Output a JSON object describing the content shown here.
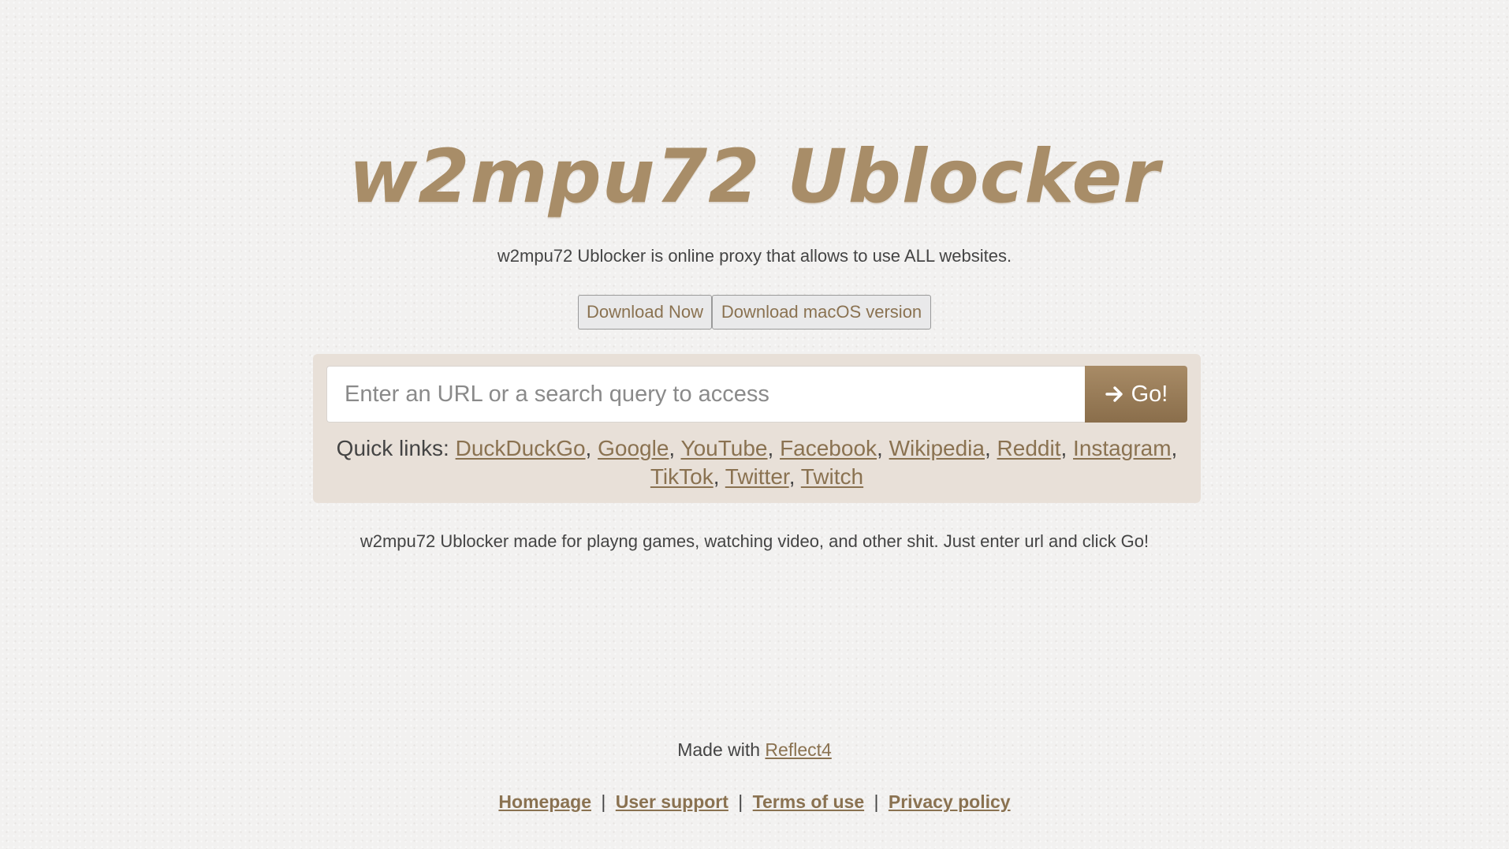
{
  "header": {
    "title": "w2mpu72 Ublocker",
    "subtitle": "w2mpu72 Ublocker is online proxy that allows to use ALL websites."
  },
  "downloads": {
    "primary_label": "Download Now",
    "macos_label": "Download macOS version"
  },
  "search": {
    "placeholder": "Enter an URL or a search query to access",
    "value": "",
    "go_label": "Go!",
    "go_icon": "arrow-right-icon"
  },
  "quick_links": {
    "label": "Quick links:",
    "items": [
      "DuckDuckGo",
      "Google",
      "YouTube",
      "Facebook",
      "Wikipedia",
      "Reddit",
      "Instagram",
      "TikTok",
      "Twitter",
      "Twitch"
    ]
  },
  "tagline": "w2mpu72 Ublocker made for playng games, watching video, and other shit. Just enter url and click Go!",
  "footer": {
    "made_with_prefix": "Made with",
    "made_with_link": "Reflect4",
    "links": [
      "Homepage",
      "User support",
      "Terms of use",
      "Privacy policy"
    ],
    "separator": "|"
  },
  "colors": {
    "accent": "#a88d68",
    "link": "#8a7251",
    "panel": "#e8e0d8",
    "background": "#f2f1f0"
  }
}
